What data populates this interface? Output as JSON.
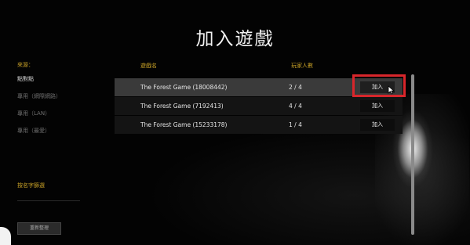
{
  "screen": {
    "title": "加入遊戲"
  },
  "sidebar": {
    "heading": "來源：",
    "items": [
      {
        "label": "點對點",
        "active": true
      },
      {
        "label": "專用（網際網路）",
        "active": false
      },
      {
        "label": "專用（LAN）",
        "active": false
      },
      {
        "label": "專用（最愛）",
        "active": false
      }
    ],
    "filter_label": "按名字篩選",
    "refresh_label": "重新整理"
  },
  "table": {
    "headers": {
      "name": "遊戲名",
      "players": "玩家人數"
    },
    "rows": [
      {
        "name": "The Forest Game (18008442)",
        "players": "2 / 4",
        "join": "加入",
        "highlighted": true
      },
      {
        "name": "The Forest Game (7192413)",
        "players": "4 / 4",
        "join": "加入",
        "highlighted": false
      },
      {
        "name": "The Forest Game (15233178)",
        "players": "1 / 4",
        "join": "加入",
        "highlighted": false
      }
    ]
  },
  "annotation": {
    "highlight_color": "#d8262b"
  },
  "colors": {
    "accent": "#c9a227",
    "background": "#030303"
  },
  "icons": {
    "cursor": "mouse-pointer-icon"
  }
}
